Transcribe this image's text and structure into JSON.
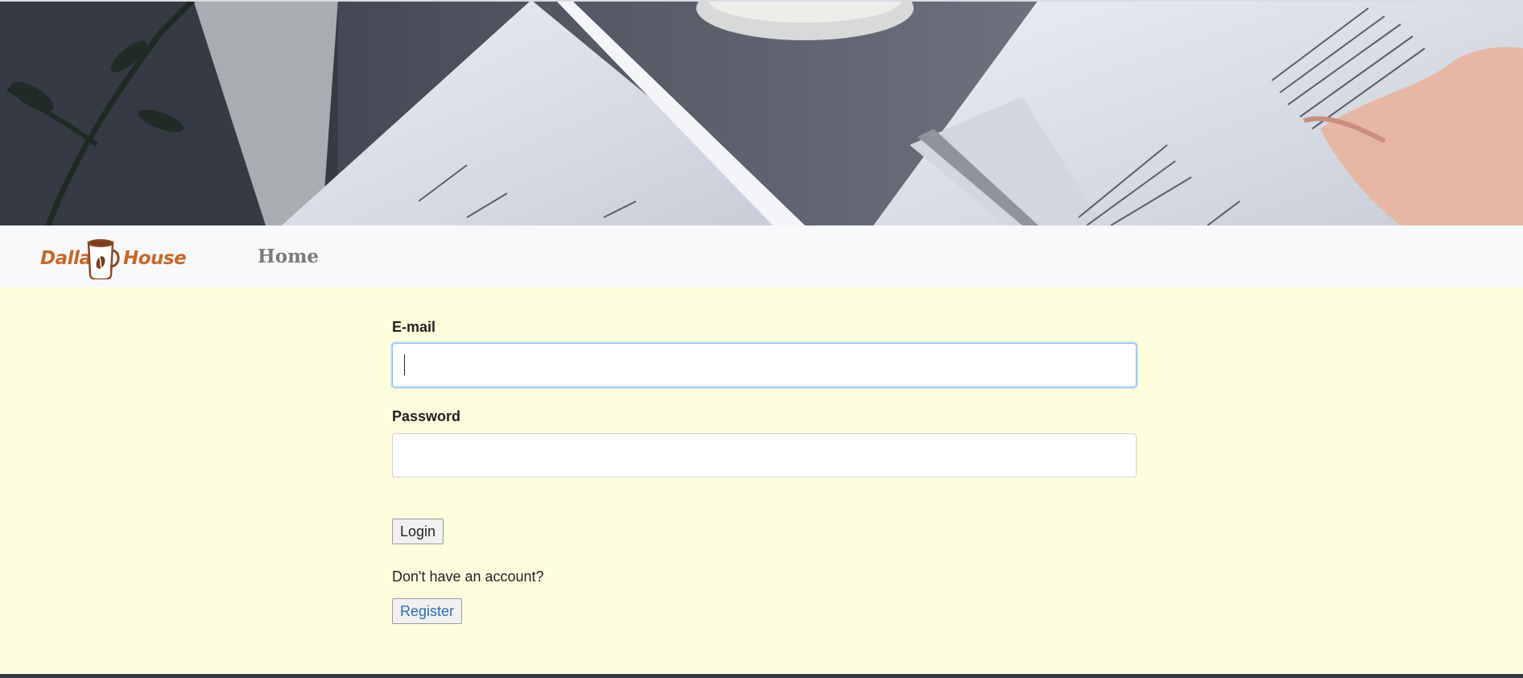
{
  "brand": {
    "name_left": "Dallas",
    "name_right": "House",
    "accent_color": "#c8692a"
  },
  "nav": {
    "home_label": "Home"
  },
  "login_form": {
    "email_label": "E-mail",
    "email_value": "",
    "password_label": "Password",
    "password_value": "",
    "login_button": "Login",
    "no_account_text": "Don't have an account?",
    "register_button": "Register"
  },
  "colors": {
    "page_background": "#fffedc",
    "navbar_background": "#f8f9fa",
    "link_blue": "#2f6fb5",
    "focus_border": "#80bdff"
  }
}
